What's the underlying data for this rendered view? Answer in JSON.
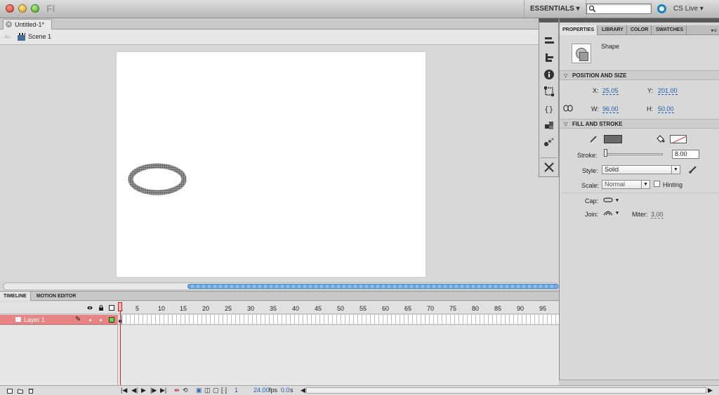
{
  "app": {
    "logo_text": "Fl"
  },
  "header": {
    "workspace": "ESSENTIALS",
    "workspace_caret": "▾",
    "search_placeholder": "",
    "cslive": "CS Live",
    "cslive_caret": "▾"
  },
  "document": {
    "tab_name": "Untitled-1*",
    "close_glyph": "✕",
    "scene": "Scene 1",
    "back_glyph": "⇐"
  },
  "timeline": {
    "tabs": [
      "TIMELINE",
      "MOTION EDITOR"
    ],
    "frame_numbers": [
      "1",
      "5",
      "10",
      "15",
      "20",
      "25",
      "30",
      "35",
      "40",
      "45",
      "50",
      "55",
      "60",
      "65",
      "70",
      "75",
      "80",
      "85",
      "90",
      "95"
    ],
    "layer_name": "Layer 1",
    "current_frame": "1",
    "fps": "24.00",
    "fps_unit": "fps",
    "time": "0.0",
    "time_unit": "s"
  },
  "properties": {
    "tabs": [
      "PROPERTIES",
      "LIBRARY",
      "COLOR",
      "SWATCHES"
    ],
    "menu_glyph": "▾≡",
    "object_type": "Shape",
    "position_size": {
      "title": "POSITION AND SIZE",
      "x_label": "X:",
      "x": "25.05",
      "y_label": "Y:",
      "y": "201.00",
      "w_label": "W:",
      "w": "96.00",
      "h_label": "H:",
      "h": "50.00"
    },
    "fill_stroke": {
      "title": "FILL AND STROKE",
      "fill_color": "#6a6a6a",
      "stroke_label": "Stroke:",
      "stroke_value": "8.00",
      "style_label": "Style:",
      "style_value": "Solid",
      "scale_label": "Scale:",
      "scale_value": "Normal",
      "hinting_label": "Hinting",
      "cap_label": "Cap:",
      "join_label": "Join:",
      "miter_label": "Miter:",
      "miter_value": "3.00"
    }
  },
  "colors": {
    "layer_highlight": "#e88483",
    "playhead": "#d02020",
    "accent_blue": "#1d5db0"
  }
}
